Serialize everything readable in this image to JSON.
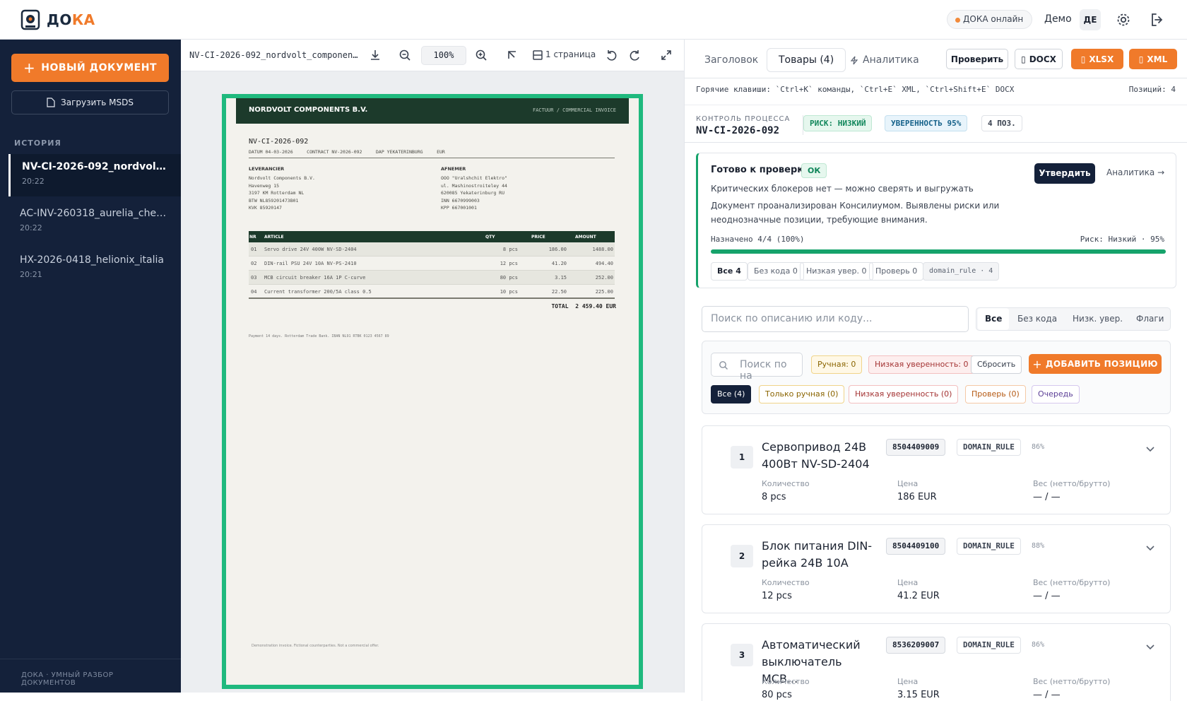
{
  "app": {
    "logo_main": "ДО",
    "logo_accent": "КА",
    "online": "ДОКА онлайн",
    "user": "Демо",
    "lang": "ДЕ"
  },
  "sidebar": {
    "new_doc": "НОВЫЙ ДОКУМЕНТ",
    "upload": "Загрузить MSDS",
    "history_title": "ИСТОРИЯ",
    "history": [
      {
        "name": "NV-CI-2026-092_nordvolt_components",
        "time": "20:22"
      },
      {
        "name": "AC-INV-260318_aurelia_chemicals",
        "time": "20:22"
      },
      {
        "name": "HX-2026-0418_helionix_italia",
        "time": "20:21"
      }
    ],
    "footer": "ДОКА · УМНЫЙ РАЗБОР ДОКУМЕНТОВ"
  },
  "viewer": {
    "file": "NV-CI-2026-092_nordvolt_components.pdf",
    "zoom": "100%",
    "pages": "1 страница"
  },
  "invoice": {
    "company": "NORDVOLT COMPONENTS B.V.",
    "type": "FACTUUR / COMMERCIAL INVOICE",
    "number": "NV-CI-2026-092",
    "meta": "DATUM 04-03-2026     CONTRACT NV-2026-092     DAP YEKATERINBURG     EUR",
    "seller_h": "LEVERANCIER",
    "seller": [
      "Nordvolt Components B.V.",
      "Havenweg 15",
      "3197 KM Rotterdam  NL",
      "BTW NL859201473B01",
      "KVK 85920147"
    ],
    "buyer_h": "AFNEMER",
    "buyer": [
      "OOO \"Uralshchit Elektro\"",
      "ul. Mashinostroiteley 44",
      "620085 Yekaterinburg  RU",
      "INN 6670999003",
      "KPP 667001001"
    ],
    "cols": [
      "NR",
      "ARTICLE",
      "QTY",
      "PRICE",
      "AMOUNT"
    ],
    "rows": [
      [
        "01",
        "Servo drive 24V 400W NV-SD-2404",
        "8 pcs",
        "186.00",
        "1488.00"
      ],
      [
        "02",
        "DIN-rail PSU 24V 10A NV-PS-2410",
        "12 pcs",
        "41.20",
        "494.40"
      ],
      [
        "03",
        "MCB circuit breaker 16A 1P C-curve",
        "80 pcs",
        "3.15",
        "252.00"
      ],
      [
        "04",
        "Current transformer 200/5A class 0.5",
        "10 pcs",
        "22.50",
        "225.00"
      ]
    ],
    "total": "TOTAL  2 459.40 EUR",
    "payment": "Payment 14 days. Rotterdam Trade Bank. IBAN NL91 RTBK 0123 4567 89",
    "footnote": "Demonstration invoice. Fictional counterparties. Not a commercial offer."
  },
  "right": {
    "tabs": [
      "Заголовок",
      "Товары (4)",
      "Аналитика"
    ],
    "check": "Проверить",
    "docx": "DOCX",
    "xlsx": "XLSX",
    "xml": "XML",
    "hotkeys": "Горячие клавиши: `Ctrl+K` команды, `Ctrl+E` XML, `Ctrl+Shift+E` DOCX",
    "positions": "Позиций: 4",
    "ctrl_label": "КОНТРОЛЬ ПРОЦЕССА",
    "ctrl_doc": "NV-CI-2026-092",
    "risk": "РИСК: НИЗКИЙ",
    "conf": "УВЕРЕННОСТЬ 95%",
    "count": "4 ПОЗ.",
    "ready_title": "Готово к проверке",
    "ok": "ОК",
    "approve": "Утвердить",
    "analytics": "Аналитика →",
    "ready_1": "Критических блокеров нет — можно сверять и выгружать",
    "ready_2": "Документ проанализирован Консилиумом. Выявлены риски или",
    "ready_3": "неоднозначные позиции, требующие внимания.",
    "assigned": "Назначено 4/4 (100%)",
    "risk_line": "Риск: Низкий · 95%",
    "pills": [
      "Все 4",
      "Без кода 0",
      "Низкая увер. 0",
      "Проверь 0",
      "domain_rule · 4"
    ],
    "search": "Поиск по описанию или коду...",
    "seg": [
      "Все",
      "Без кода",
      "Низк. увер.",
      "Флаги"
    ],
    "search2": "Поиск по на",
    "manual": "Ручная: 0",
    "lowconf": "Низкая уверенность: 0",
    "reset": "Сбросить",
    "add": "ДОБАВИТЬ ПОЗИЦИЮ",
    "filters": [
      "Все (4)",
      "Только ручная (0)",
      "Низкая уверенность (0)",
      "Проверь (0)",
      "Очередь"
    ],
    "lbl_qty": "Количество",
    "lbl_price": "Цена",
    "lbl_weight": "Вес (нетто/брутто)",
    "items": [
      {
        "n": "1",
        "title": "Сервопривод 24В 400Вт NV-SD-2404",
        "code": "8504409009",
        "rule": "DOMAIN_RULE",
        "pct": "86%",
        "qty": "8 pcs",
        "price": "186 EUR",
        "weight": "— / —"
      },
      {
        "n": "2",
        "title": "Блок питания DIN-рейка 24В 10А",
        "code": "8504409100",
        "rule": "DOMAIN_RULE",
        "pct": "88%",
        "qty": "12 pcs",
        "price": "41.2 EUR",
        "weight": "— / —"
      },
      {
        "n": "3",
        "title": "Автоматический выключатель MCB...",
        "code": "8536209007",
        "rule": "DOMAIN_RULE",
        "pct": "86%",
        "qty": "80 pcs",
        "price": "3.15 EUR",
        "weight": "— / —"
      }
    ]
  }
}
